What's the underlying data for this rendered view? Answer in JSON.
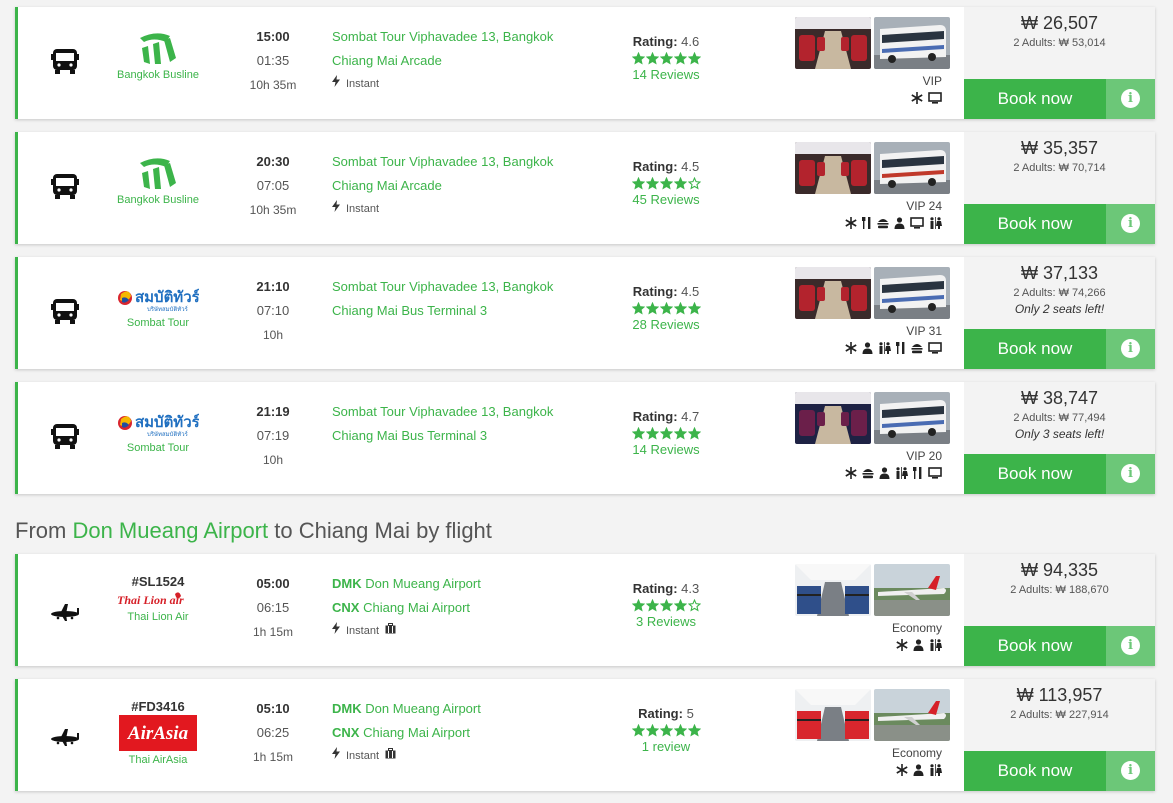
{
  "results": [
    {
      "type": "bus",
      "operator": "Bangkok Busline",
      "logo": "bangkok-busline",
      "flight": "",
      "dep": "15:00",
      "arr": "01:35",
      "dur": "10h 35m",
      "from_code": "",
      "from": "Sombat Tour Viphavadee 13, Bangkok",
      "to_code": "",
      "to": "Chiang Mai Arcade",
      "instant": "Instant",
      "luggage": false,
      "rating_label": "Rating:",
      "rating": "4.6",
      "stars": 5,
      "reviews": "14 Reviews",
      "class": "VIP",
      "amenities": [
        "snowflake-icon",
        "monitor-icon"
      ],
      "price": "₩ 26,507",
      "adults": "2 Adults: ₩ 53,014",
      "seats": "",
      "book": "Book now",
      "p1": "bus-interior-red",
      "p2": "bus-exterior-white"
    },
    {
      "type": "bus",
      "operator": "Bangkok Busline",
      "logo": "bangkok-busline",
      "flight": "",
      "dep": "20:30",
      "arr": "07:05",
      "dur": "10h 35m",
      "from_code": "",
      "from": "Sombat Tour Viphavadee 13, Bangkok",
      "to_code": "",
      "to": "Chiang Mai Arcade",
      "instant": "Instant",
      "luggage": false,
      "rating_label": "Rating:",
      "rating": "4.5",
      "stars": 4,
      "reviews": "45 Reviews",
      "class": "VIP 24",
      "amenities": [
        "snowflake-icon",
        "utensils-icon",
        "burger-icon",
        "person-icon",
        "monitor-icon",
        "restroom-icon"
      ],
      "price": "₩ 35,357",
      "adults": "2 Adults: ₩ 70,714",
      "seats": "",
      "book": "Book now",
      "p1": "bus-interior-dark",
      "p2": "bus-exterior-red"
    },
    {
      "type": "bus",
      "operator": "Sombat Tour",
      "logo": "sombat-tour",
      "flight": "",
      "dep": "21:10",
      "arr": "07:10",
      "dur": "10h",
      "from_code": "",
      "from": "Sombat Tour Viphavadee 13, Bangkok",
      "to_code": "",
      "to": "Chiang Mai Bus Terminal 3",
      "instant": "",
      "luggage": false,
      "rating_label": "Rating:",
      "rating": "4.5",
      "stars": 5,
      "reviews": "28 Reviews",
      "class": "VIP 31",
      "amenities": [
        "snowflake-icon",
        "person-icon",
        "restroom-icon",
        "utensils-icon",
        "burger-icon",
        "monitor-icon"
      ],
      "price": "₩ 37,133",
      "adults": "2 Adults: ₩ 74,266",
      "seats": "Only 2 seats left!",
      "book": "Book now",
      "p1": "bus-interior-red",
      "p2": "bus-exterior-white"
    },
    {
      "type": "bus",
      "operator": "Sombat Tour",
      "logo": "sombat-tour",
      "flight": "",
      "dep": "21:19",
      "arr": "07:19",
      "dur": "10h",
      "from_code": "",
      "from": "Sombat Tour Viphavadee 13, Bangkok",
      "to_code": "",
      "to": "Chiang Mai Bus Terminal 3",
      "instant": "",
      "luggage": false,
      "rating_label": "Rating:",
      "rating": "4.7",
      "stars": 5,
      "reviews": "14 Reviews",
      "class": "VIP 20",
      "amenities": [
        "snowflake-icon",
        "burger-icon",
        "person-icon",
        "restroom-icon",
        "utensils-icon",
        "monitor-icon"
      ],
      "price": "₩ 38,747",
      "adults": "2 Adults: ₩ 77,494",
      "seats": "Only 3 seats left!",
      "book": "Book now",
      "p1": "bus-interior-purple",
      "p2": "bus-exterior-white"
    },
    {
      "type": "plane",
      "operator": "Thai Lion Air",
      "logo": "thai-lion-air",
      "logo_text": "Thai Lion air",
      "flight": "#SL1524",
      "dep": "05:00",
      "arr": "06:15",
      "dur": "1h 15m",
      "from_code": "DMK",
      "from": "Don Mueang Airport",
      "to_code": "CNX",
      "to": "Chiang Mai Airport",
      "instant": "Instant",
      "luggage": true,
      "rating_label": "Rating:",
      "rating": "4.3",
      "stars": 4,
      "reviews": "3 Reviews",
      "class": "Economy",
      "amenities": [
        "snowflake-icon",
        "person-icon",
        "restroom-icon"
      ],
      "price": "₩ 94,335",
      "adults": "2 Adults: ₩ 188,670",
      "seats": "",
      "book": "Book now",
      "p1": "plane-interior-blue",
      "p2": "plane-exterior-red"
    },
    {
      "type": "plane",
      "operator": "Thai AirAsia",
      "logo": "airasia",
      "logo_text": "AirAsia",
      "flight": "#FD3416",
      "dep": "05:10",
      "arr": "06:25",
      "dur": "1h 15m",
      "from_code": "DMK",
      "from": "Don Mueang Airport",
      "to_code": "CNX",
      "to": "Chiang Mai Airport",
      "instant": "Instant",
      "luggage": true,
      "rating_label": "Rating:",
      "rating": "5",
      "stars": 5,
      "reviews": "1 review",
      "class": "Economy",
      "amenities": [
        "snowflake-icon",
        "person-icon",
        "restroom-icon"
      ],
      "price": "₩ 113,957",
      "adults": "2 Adults: ₩ 227,914",
      "seats": "",
      "book": "Book now",
      "p1": "plane-interior-red",
      "p2": "plane-exterior-red"
    }
  ],
  "section_heading": {
    "prefix": "From ",
    "place": "Don Mueang Airport",
    "suffix": " to Chiang Mai by flight"
  },
  "colors": {
    "accent": "#3cb44a",
    "accent_light": "#6cc778",
    "price_bg": "#f3f3f3"
  }
}
